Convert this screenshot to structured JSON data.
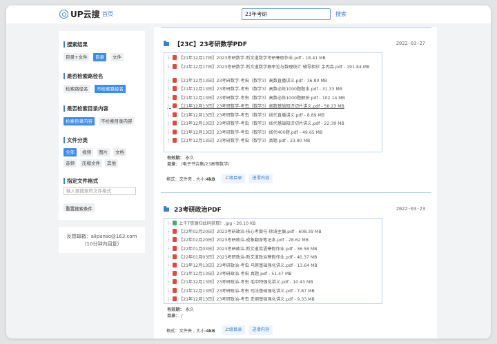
{
  "header": {
    "logo_text": "UP云搜",
    "home_link": "首页",
    "search_value": "23年考研",
    "search_button": "搜索"
  },
  "sidebar": {
    "groups": [
      {
        "title": "搜索结果",
        "options": [
          "目录+文件",
          "目录",
          "文件"
        ],
        "active": 1
      },
      {
        "title": "是否检索路径名",
        "options": [
          "检索路径名",
          "不检索路径名"
        ],
        "active": 1
      },
      {
        "title": "是否检索目录内容",
        "options": [
          "检索目录内容",
          "不检索目录内容"
        ],
        "active": 0
      },
      {
        "title": "文件分类",
        "options": [
          "全部",
          "视频",
          "图片",
          "文档",
          "音频",
          "压缩文件",
          "其他"
        ],
        "active": 0
      },
      {
        "title": "指定文件格式"
      }
    ],
    "ext_placeholder": "输入要搜索的文件格式",
    "reset_button": "重置搜索条件",
    "contact_line1": "反馈邮箱：alipanso@163.com",
    "contact_line2": "(10分钟内回复)"
  },
  "results": [
    {
      "title": "【23C】23考研数学PDF",
      "date": "2022-03-27",
      "files": [
        {
          "type": "pdf",
          "name": "【21年12月17日】2023考研数学-新文道数学考研寒假作业.pdf",
          "size": "18.41 MB"
        },
        {
          "type": "pdf",
          "name": "【21年12月17日】2023考研数学-新文道数学概率论与数理统计 辅导相伙 余丙森.pdf",
          "size": "191.84 MB"
        },
        {
          "type": "pdf",
          "name": "【21年12月13日】23考研数学-考虫（数学3）高数直播讲义.pdf",
          "size": "36.80 MB"
        },
        {
          "type": "pdf",
          "name": "【21年12月13日】23考研数学-考虫（数学3）高数必练1000题题本.pdf",
          "size": "31.33 MB"
        },
        {
          "type": "pdf",
          "name": "【21年12月13日】23考研数学-考虫（数学3）高数必练1000题解析.pdf",
          "size": "102.14 MB"
        },
        {
          "type": "pdf",
          "name": "【21年12月13日】23考研数学-考虫（数学3）高数基础知识切片讲义.pdf",
          "size": "58.23 MB"
        },
        {
          "type": "pdf",
          "name": "【21年12月13日】23考研数学-考虫（数学3）线代直播讲义.pdf",
          "size": "8.89 MB"
        },
        {
          "type": "pdf",
          "name": "【21年12月13日】23考研数学-考虫（数学3）线代基础知识切片讲义.pdf",
          "size": "22.39 MB"
        },
        {
          "type": "pdf",
          "name": "【21年12月13日】23考研数学-考虫（数学3）线代400题.pdf",
          "size": "49.65 MB"
        },
        {
          "type": "pdf",
          "name": "【21年12月13日】23考研数学-考虫（数学3）真题.pdf",
          "size": "23.80 MB"
        }
      ],
      "validity_label": "有效期：",
      "validity": "永久",
      "dir_label": "目录：",
      "dir": "/电子书合集/23高等数学/",
      "format_label": "格式：",
      "format": "文件夹",
      "size_label": "大小:",
      "size": "4kB",
      "btn_up": "上级目录",
      "btn_enter": "进滑内容"
    },
    {
      "title": "23考研政治PDF",
      "date": "2022-03-23",
      "files": [
        {
          "type": "img",
          "name": "上千T资源扫此码获取！.jpg",
          "size": "26.10 KB"
        },
        {
          "type": "pdf",
          "name": "【22年02月20日】2023考研政治-核心考案句-徐涛主编.pdf",
          "size": "608.39 MB"
        },
        {
          "type": "pdf",
          "name": "【22年02月20日】2023考研政治-成象翻身笔记本.pdf",
          "size": "28.62 MB"
        },
        {
          "type": "pdf",
          "name": "【22年01月03日】2023考研政治-新文道英语寒假作业.pdf",
          "size": "36.58 MB"
        },
        {
          "type": "pdf",
          "name": "【22年01月03日】2023考研政治-新文道政治寒假作业.pdf",
          "size": "40.37 MB"
        },
        {
          "type": "pdf",
          "name": "【21年12月13日】23考研政治-考虫 马原基础强化讲义.pdf",
          "size": "13.64 MB"
        },
        {
          "type": "pdf",
          "name": "【21年12月13日】23考研政治-考虫 真题.pdf",
          "size": "51.47 MB"
        },
        {
          "type": "pdf",
          "name": "【21年12月13日】23考研政治-考虫 毛中特强化讲义.pdf",
          "size": "10.43 MB"
        },
        {
          "type": "pdf",
          "name": "【21年12月13日】23考研政治-考虫 司法基础强化讲义.pdf",
          "size": "7.87 MB"
        },
        {
          "type": "pdf",
          "name": "【21年12月13日】23考研政治-考虫 史纲基础强化讲义.pdf",
          "size": "9.33 MB"
        }
      ],
      "validity_label": "有效期：",
      "validity": "永久",
      "dir_label": "目录：",
      "dir": "/",
      "format_label": "格式：",
      "format": "文件夹",
      "size_label": "大小:",
      "size": "4kB",
      "btn_up": "上级目录",
      "btn_enter": "进滑内容"
    }
  ],
  "colors": {
    "accent": "#3b7dd8",
    "active_tag": "#3b8cf0",
    "pdf_icon": "#e04a3e",
    "box_border": "#b8d4f3"
  }
}
